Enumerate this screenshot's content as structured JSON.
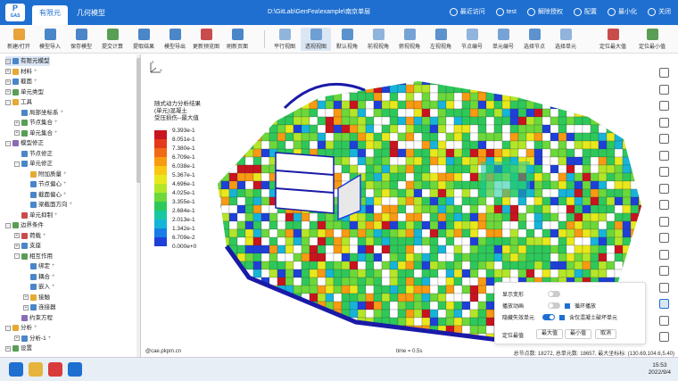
{
  "app": {
    "logo_text": "P",
    "logo_sub": "GAS",
    "tabs": [
      "有限元",
      "几何模型"
    ],
    "window_title": "D:\\GitLab\\GenFea\\example\\南京单层",
    "top_actions": [
      "最近访问",
      "test",
      "解除授权",
      "配置",
      "最小化",
      "关闭"
    ]
  },
  "toolbar": {
    "left": [
      "新建/打开",
      "模型导入",
      "保存模型",
      "提交计算",
      "提取结果",
      "模型导出",
      "更新预览图",
      "刷新页面"
    ],
    "view": [
      "平行视图",
      "透视视图",
      "默认视角",
      "前视视角",
      "俯视视角",
      "左视视角",
      "节点编号",
      "单元编号",
      "选择节点",
      "选择单元"
    ],
    "locate": [
      "定位最大值",
      "定位最小值"
    ],
    "active": "透视视图"
  },
  "tree": [
    {
      "label": "有限元模型",
      "level": 0,
      "expander": "-",
      "icon": "b",
      "sel": true
    },
    {
      "label": "材料",
      "level": 0,
      "expander": "+",
      "icon": "y",
      "plus": true
    },
    {
      "label": "截面",
      "level": 0,
      "expander": "+",
      "icon": "b",
      "plus": true
    },
    {
      "label": "单元类型",
      "level": 0,
      "expander": "+",
      "icon": "g"
    },
    {
      "label": "工具",
      "level": 0,
      "expander": "-",
      "icon": "y"
    },
    {
      "label": "局部坐标系",
      "level": 1,
      "expander": "",
      "icon": "b",
      "plus": true
    },
    {
      "label": "节点集合",
      "level": 1,
      "expander": "+",
      "icon": "g",
      "plus": true
    },
    {
      "label": "单元集合",
      "level": 1,
      "expander": "+",
      "icon": "g",
      "plus": true
    },
    {
      "label": "模型修正",
      "level": 0,
      "expander": "-",
      "icon": "p"
    },
    {
      "label": "节点修正",
      "level": 1,
      "expander": "",
      "icon": "b"
    },
    {
      "label": "单元修正",
      "level": 1,
      "expander": "-",
      "icon": "b"
    },
    {
      "label": "附加质量",
      "level": 2,
      "expander": "",
      "icon": "y",
      "plus": true
    },
    {
      "label": "节点偏心",
      "level": 2,
      "expander": "",
      "icon": "b",
      "plus": true
    },
    {
      "label": "截面偏心",
      "level": 2,
      "expander": "",
      "icon": "b",
      "plus": true
    },
    {
      "label": "梁截面方向",
      "level": 2,
      "expander": "",
      "icon": "b",
      "plus": true
    },
    {
      "label": "单元抑制",
      "level": 1,
      "expander": "",
      "icon": "r",
      "plus": true
    },
    {
      "label": "边界条件",
      "level": 0,
      "expander": "-",
      "icon": "g"
    },
    {
      "label": "荷载",
      "level": 1,
      "expander": "+",
      "icon": "r",
      "plus": true
    },
    {
      "label": "支座",
      "level": 1,
      "expander": "+",
      "icon": "b"
    },
    {
      "label": "相互作用",
      "level": 1,
      "expander": "-",
      "icon": "g"
    },
    {
      "label": "绑定",
      "level": 2,
      "expander": "",
      "icon": "b",
      "plus": true
    },
    {
      "label": "耦合",
      "level": 2,
      "expander": "",
      "icon": "b",
      "plus": true
    },
    {
      "label": "嵌入",
      "level": 2,
      "expander": "",
      "icon": "b",
      "plus": true
    },
    {
      "label": "接触",
      "level": 2,
      "expander": "+",
      "icon": "y"
    },
    {
      "label": "连接器",
      "level": 2,
      "expander": "+",
      "icon": "b"
    },
    {
      "label": "约束方程",
      "level": 1,
      "expander": "",
      "icon": "p"
    },
    {
      "label": "分析",
      "level": 0,
      "expander": "-",
      "icon": "y",
      "plus": true
    },
    {
      "label": "分析-1",
      "level": 1,
      "expander": "+",
      "icon": "b",
      "plus": true
    },
    {
      "label": "设置",
      "level": 0,
      "expander": "+",
      "icon": "g"
    }
  ],
  "legend": {
    "title": "随式动力分析结果\n(单元)混凝土\n受压损伤--最大值",
    "values": [
      "9.393e-1",
      "8.051e-1",
      "7.380e-1",
      "6.709e-1",
      "6.038e-1",
      "5.367e-1",
      "4.696e-1",
      "4.025e-1",
      "3.355e-1",
      "2.684e-1",
      "2.013e-1",
      "1.342e-1",
      "6.709e-2",
      "0.000e+0"
    ],
    "colors": [
      "#c8141e",
      "#e23a1a",
      "#f06a16",
      "#f89a12",
      "#f8c814",
      "#e8e81c",
      "#b4e628",
      "#6cd83a",
      "#2ec85a",
      "#18c8a0",
      "#16b4d8",
      "#1a7ce6",
      "#1e40d8",
      "#1a1aa8"
    ]
  },
  "panel": {
    "show_deform": "显示变形",
    "play_anim": "播放动画",
    "loop_play": "循环播放",
    "hide_failed": "隐藏失效单元",
    "concrete_only": "含仅混凝土破坏单元",
    "locate_label": "定位最值",
    "max_btn": "最大值",
    "min_btn": "最小值",
    "cancel_btn": "取消"
  },
  "status": {
    "site": "@cae.pkpm.cn",
    "time": "time = 0.5s",
    "stats": "总节点数: 18272, 总单元数: 18657, 最大坐标标: (130.69,104.6,5.40)"
  },
  "clock": {
    "time": "15:53",
    "date": "2022/9/4"
  }
}
